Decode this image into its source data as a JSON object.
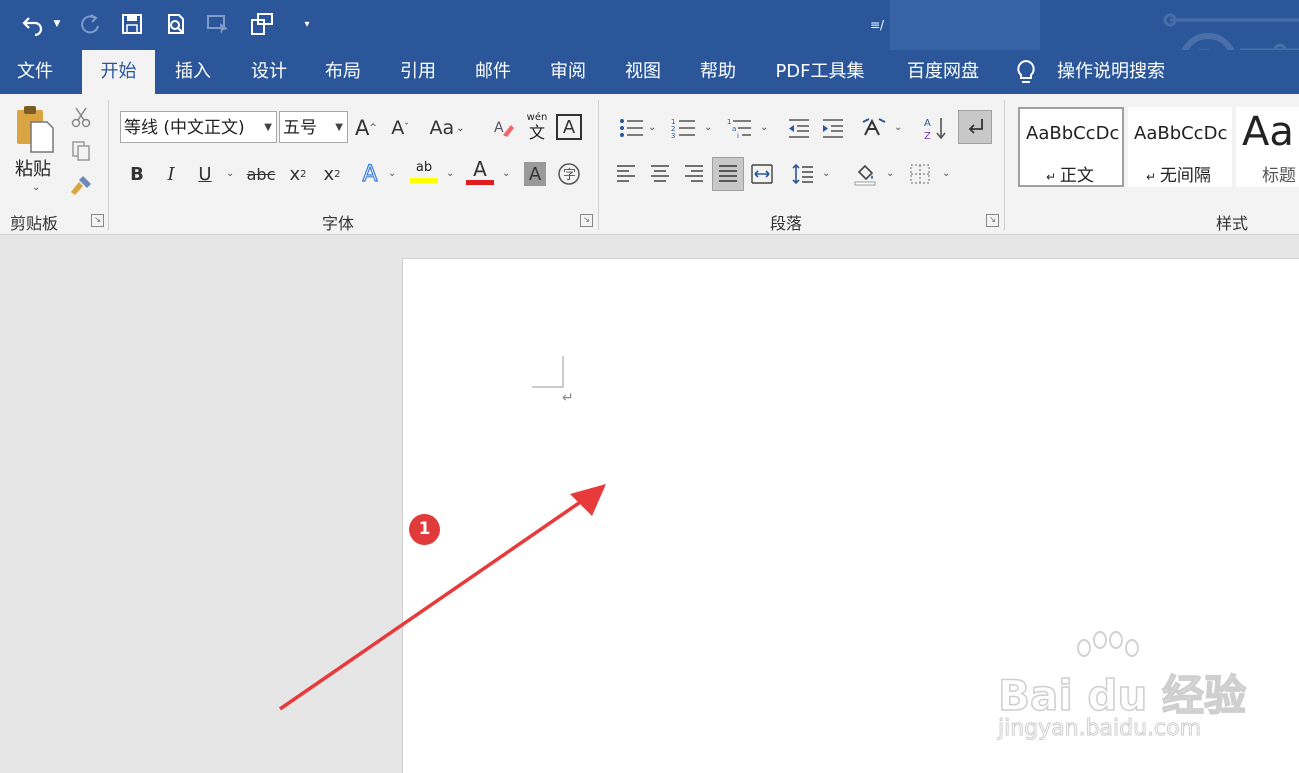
{
  "app": {
    "title": "≡/"
  },
  "qat": {
    "undo_icon": "undo-icon",
    "redo_icon": "redo-icon",
    "save_icon": "save-icon",
    "preview_icon": "print-preview-icon",
    "touch_icon": "touch-mode-icon",
    "format_icon": "format-icon"
  },
  "tabs": [
    {
      "label": "文件"
    },
    {
      "label": "开始"
    },
    {
      "label": "插入"
    },
    {
      "label": "设计"
    },
    {
      "label": "布局"
    },
    {
      "label": "引用"
    },
    {
      "label": "邮件"
    },
    {
      "label": "审阅"
    },
    {
      "label": "视图"
    },
    {
      "label": "帮助"
    },
    {
      "label": "PDF工具集"
    },
    {
      "label": "百度网盘"
    }
  ],
  "search": {
    "label": "操作说明搜索"
  },
  "clipboard": {
    "paste_label": "粘贴",
    "group_label": "剪贴板"
  },
  "font": {
    "name": "等线 (中文正文)",
    "size": "五号",
    "group_label": "字体",
    "aa_label": "Aa",
    "bold": "B",
    "italic": "I",
    "underline": "U",
    "strike": "abc",
    "sub": "x",
    "sub_mark": "2",
    "sup": "x",
    "sup_mark": "2",
    "wen_top": "wén",
    "wen_bottom": "文",
    "border_a": "A",
    "grow": "A",
    "shrink": "A",
    "effects": "A",
    "color_a": "A",
    "shade_a": "A",
    "highlight": "ab",
    "phonetic": "字"
  },
  "paragraph": {
    "group_label": "段落"
  },
  "styles": {
    "group_label": "样式",
    "items": [
      {
        "preview": "AaBbCcDc",
        "label": "正文"
      },
      {
        "preview": "AaBbCcDc",
        "label": "无间隔"
      },
      {
        "preview": "Aa",
        "label": "标题"
      }
    ]
  },
  "document": {
    "paragraph_mark": "↵"
  },
  "annotation": {
    "step_number": "1"
  },
  "watermark": {
    "brand": "Bai du 经验",
    "url": "jingyan.baidu.com"
  },
  "colors": {
    "accent": "#2b579a",
    "highlight": "#ffff00",
    "font_color": "#e01b1b",
    "arrow": "#e83a3a"
  }
}
